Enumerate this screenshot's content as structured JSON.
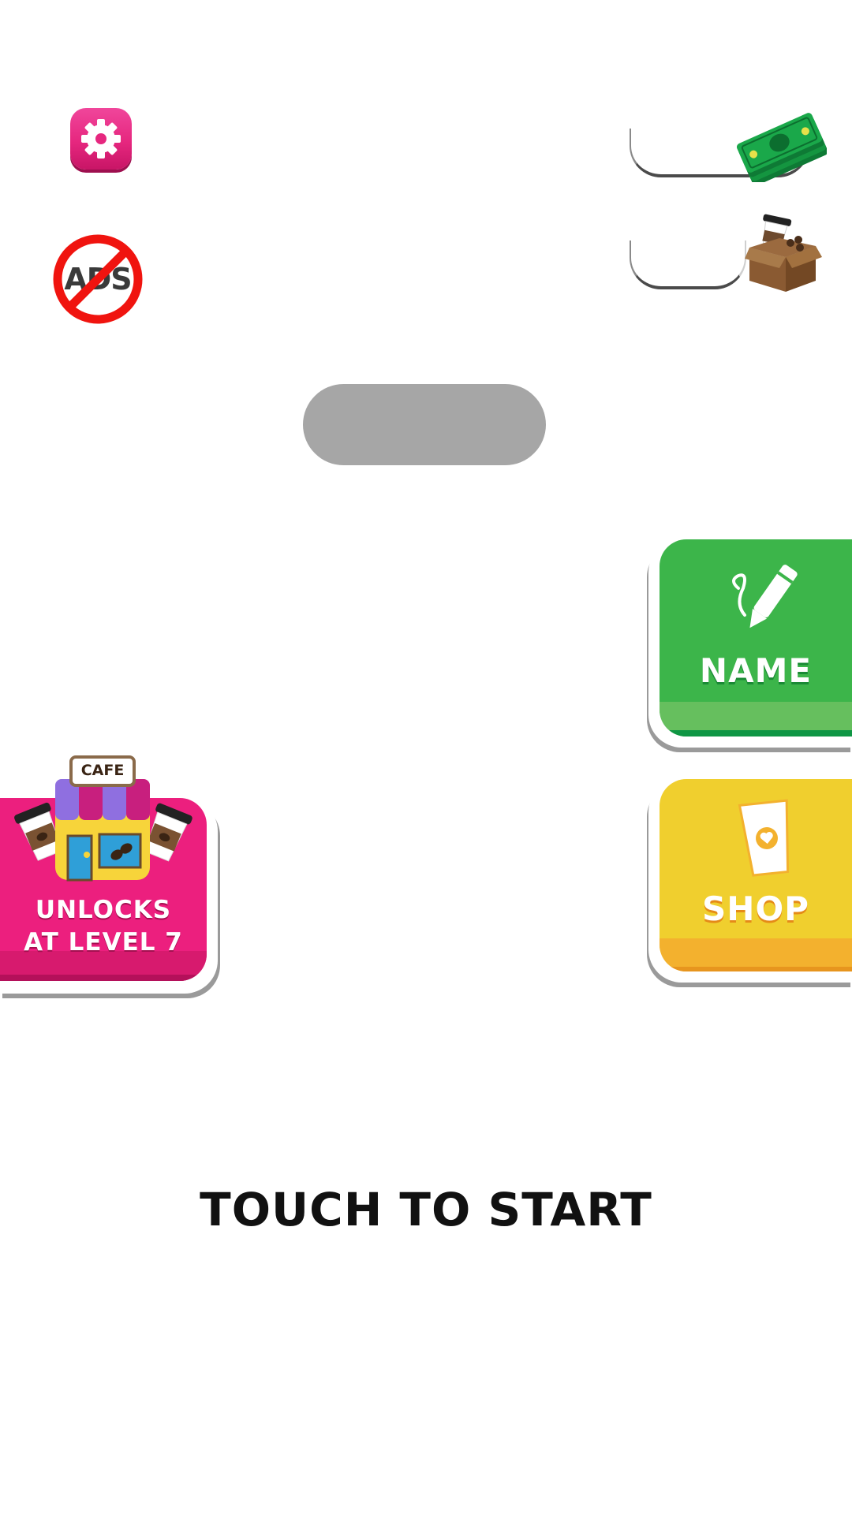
{
  "hud": {
    "cash_value": "",
    "beans_value": "",
    "level_text": ""
  },
  "buttons": {
    "no_ads_text": "ADS",
    "name_label": "NAME",
    "shop_label": "SHOP",
    "cafe_sign": "CAFE",
    "cafe_locked_line1": "UNLOCKS",
    "cafe_locked_line2": "AT LEVEL 7"
  },
  "prompt": {
    "touch_to_start": "TOUCH TO START"
  },
  "colors": {
    "settings": "#e6277f",
    "name_button": "#3cb54a",
    "shop_button": "#f0cf2e",
    "cafe_button": "#ec1f7e",
    "level_pill": "#a6a6a6",
    "no_ads_ring": "#f0140f"
  },
  "icons": [
    "gear-icon",
    "no-ads-icon",
    "cash-icon",
    "coffee-box-icon",
    "pencil-icon",
    "coffee-cup-icon",
    "cafe-shop-icon"
  ]
}
